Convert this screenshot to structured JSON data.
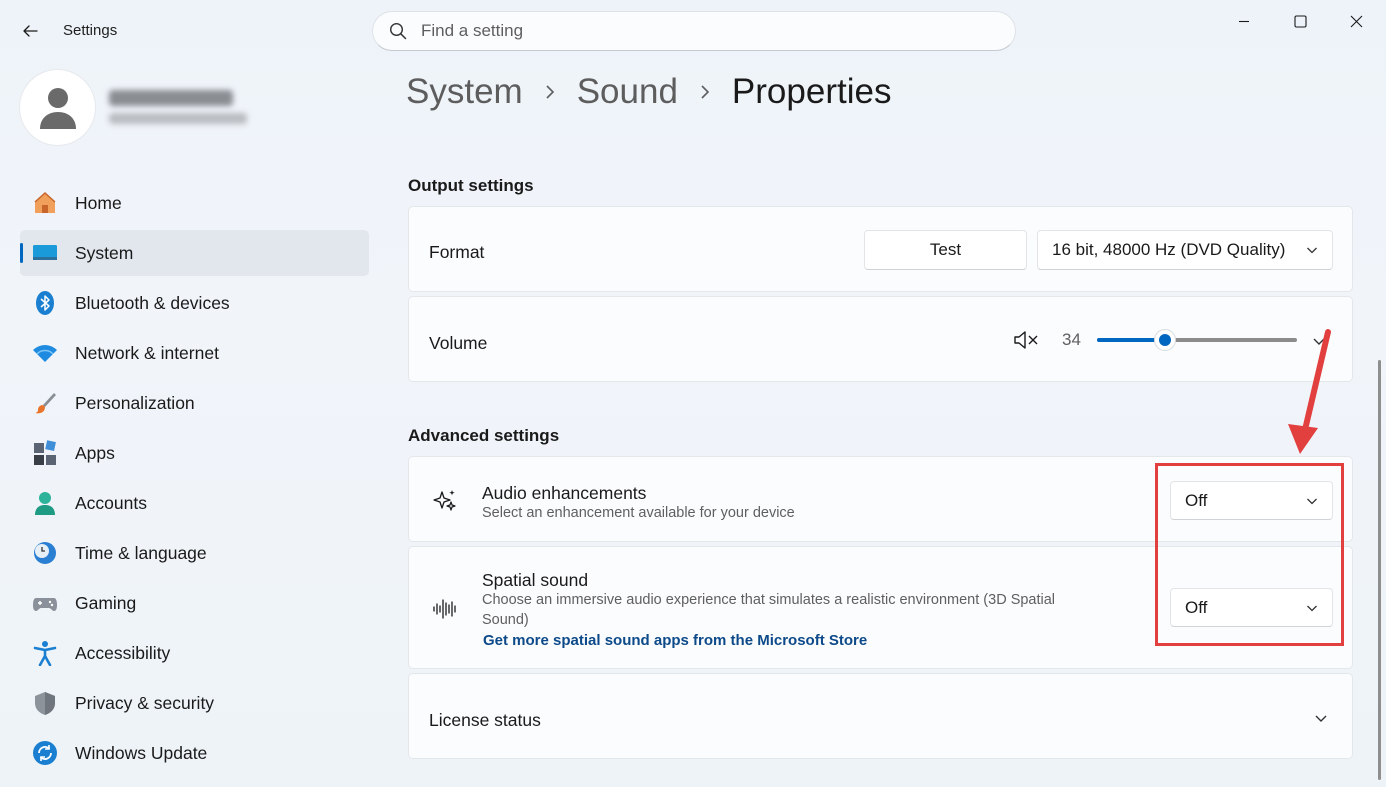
{
  "window": {
    "title": "Settings",
    "controls": [
      "minimize",
      "maximize",
      "close"
    ]
  },
  "search": {
    "placeholder": "Find a setting"
  },
  "sidebar": {
    "items": [
      {
        "label": "Home",
        "icon": "home-icon"
      },
      {
        "label": "System",
        "icon": "system-icon",
        "selected": true
      },
      {
        "label": "Bluetooth & devices",
        "icon": "bluetooth-icon"
      },
      {
        "label": "Network & internet",
        "icon": "wifi-icon"
      },
      {
        "label": "Personalization",
        "icon": "brush-icon"
      },
      {
        "label": "Apps",
        "icon": "apps-icon"
      },
      {
        "label": "Accounts",
        "icon": "accounts-icon"
      },
      {
        "label": "Time & language",
        "icon": "clock-globe-icon"
      },
      {
        "label": "Gaming",
        "icon": "gamepad-icon"
      },
      {
        "label": "Accessibility",
        "icon": "accessibility-icon"
      },
      {
        "label": "Privacy & security",
        "icon": "shield-icon"
      },
      {
        "label": "Windows Update",
        "icon": "update-icon"
      }
    ]
  },
  "breadcrumb": {
    "level1": "System",
    "level2": "Sound",
    "current": "Properties"
  },
  "output": {
    "section_title": "Output settings",
    "format_label": "Format",
    "test_button": "Test",
    "format_value": "16 bit, 48000 Hz (DVD Quality)",
    "volume_label": "Volume",
    "volume_value": "34",
    "volume_level": 34
  },
  "advanced": {
    "section_title": "Advanced settings",
    "audio_enhancements": {
      "title": "Audio enhancements",
      "description": "Select an enhancement available for your device",
      "value": "Off"
    },
    "spatial_sound": {
      "title": "Spatial sound",
      "description": "Choose an immersive audio experience that simulates a realistic environment (3D Spatial Sound)",
      "link": "Get more spatial sound apps from the Microsoft Store",
      "value": "Off"
    },
    "license_status": {
      "title": "License status"
    }
  },
  "colors": {
    "accent": "#0067c0",
    "annotation": "#e2403e"
  }
}
